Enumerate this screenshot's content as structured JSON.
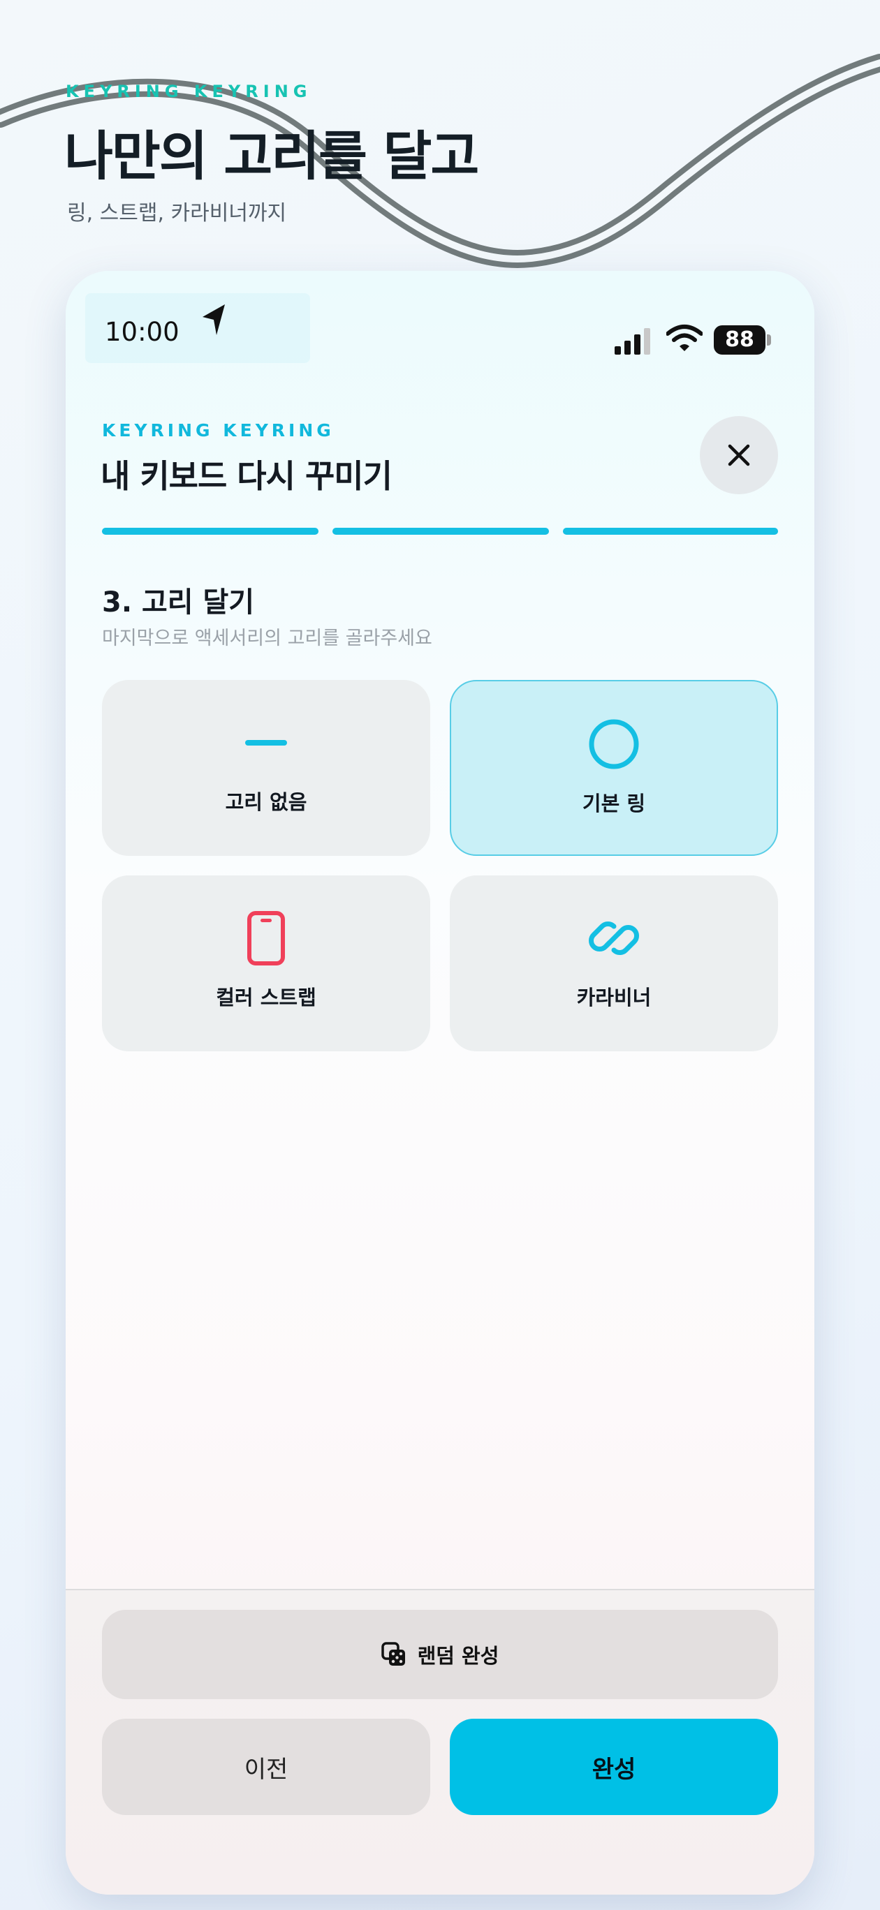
{
  "promo": {
    "kicker": "KEYRING KEYRING",
    "title": "나만의 고리를 달고",
    "subtitle": "링, 스트랩, 카라비너까지"
  },
  "status_bar": {
    "time": "10:00",
    "battery": "88"
  },
  "header": {
    "kicker": "KEYRING KEYRING",
    "title": "내 키보드 다시 꾸미기",
    "progress_steps": 3,
    "progress_completed": 3
  },
  "step": {
    "title": "3. 고리 달기",
    "subtitle": "마지막으로 액세서리의 고리를 골라주세요"
  },
  "options": [
    {
      "label": "고리 없음",
      "icon": "dash-icon",
      "selected": false
    },
    {
      "label": "기본 링",
      "icon": "ring-icon",
      "selected": true
    },
    {
      "label": "컬러 스트랩",
      "icon": "strap-icon",
      "selected": false
    },
    {
      "label": "카라비너",
      "icon": "link-icon",
      "selected": false
    }
  ],
  "footer": {
    "random_label": "랜덤 완성",
    "prev_label": "이전",
    "done_label": "완성"
  },
  "colors": {
    "accent": "#00c0e6",
    "kicker_teal": "#17c3b2",
    "strap_red": "#f0405a"
  }
}
